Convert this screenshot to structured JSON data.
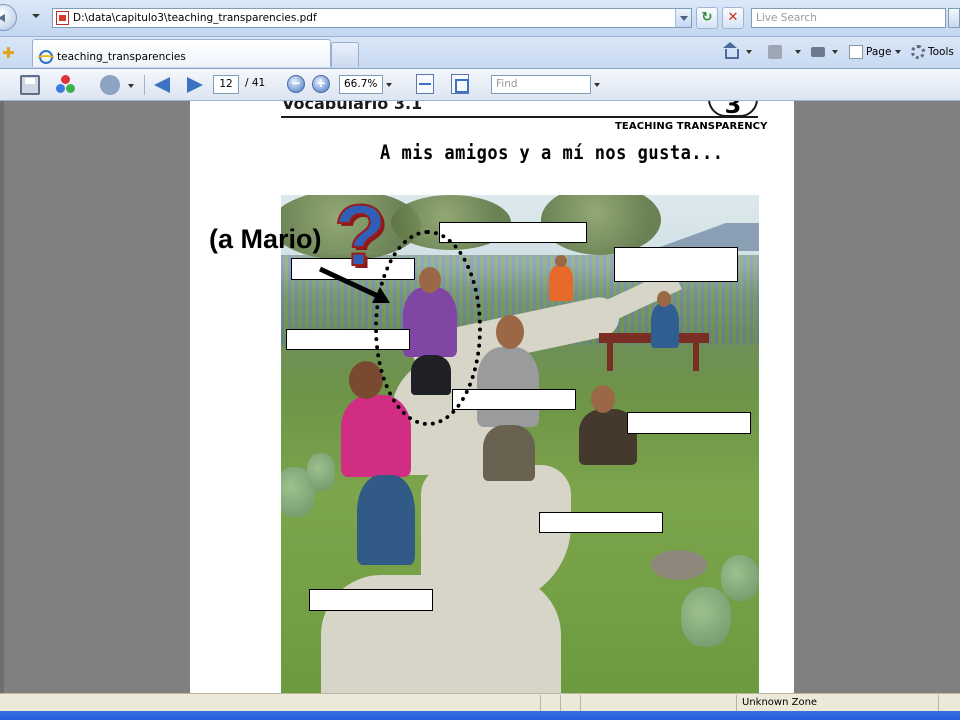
{
  "browser": {
    "address": "D:\\data\\capitulo3\\teaching_transparencies.pdf",
    "search_placeholder": "Live Search",
    "tab_title": "teaching_transparencies",
    "commands": {
      "page": "Page",
      "tools": "Tools"
    }
  },
  "pdf_toolbar": {
    "current_page": "12",
    "total_pages": "/ 41",
    "zoom": "66.7%",
    "find_placeholder": "Find"
  },
  "document": {
    "section_title": "Vocabulario 3.1",
    "chapter_number": "3",
    "transparency_label": "TEACHING TRANSPARENCY",
    "heading": "A mis amigos y a mí nos gusta..."
  },
  "overlay": {
    "mario_label": "(a Mario)",
    "question_mark": "?"
  },
  "status": {
    "zone": "Unknown Zone"
  },
  "colors": {
    "question_blue": "#2f5fb7",
    "question_outline": "#9b1b1b",
    "viewer_gray": "#808080"
  }
}
